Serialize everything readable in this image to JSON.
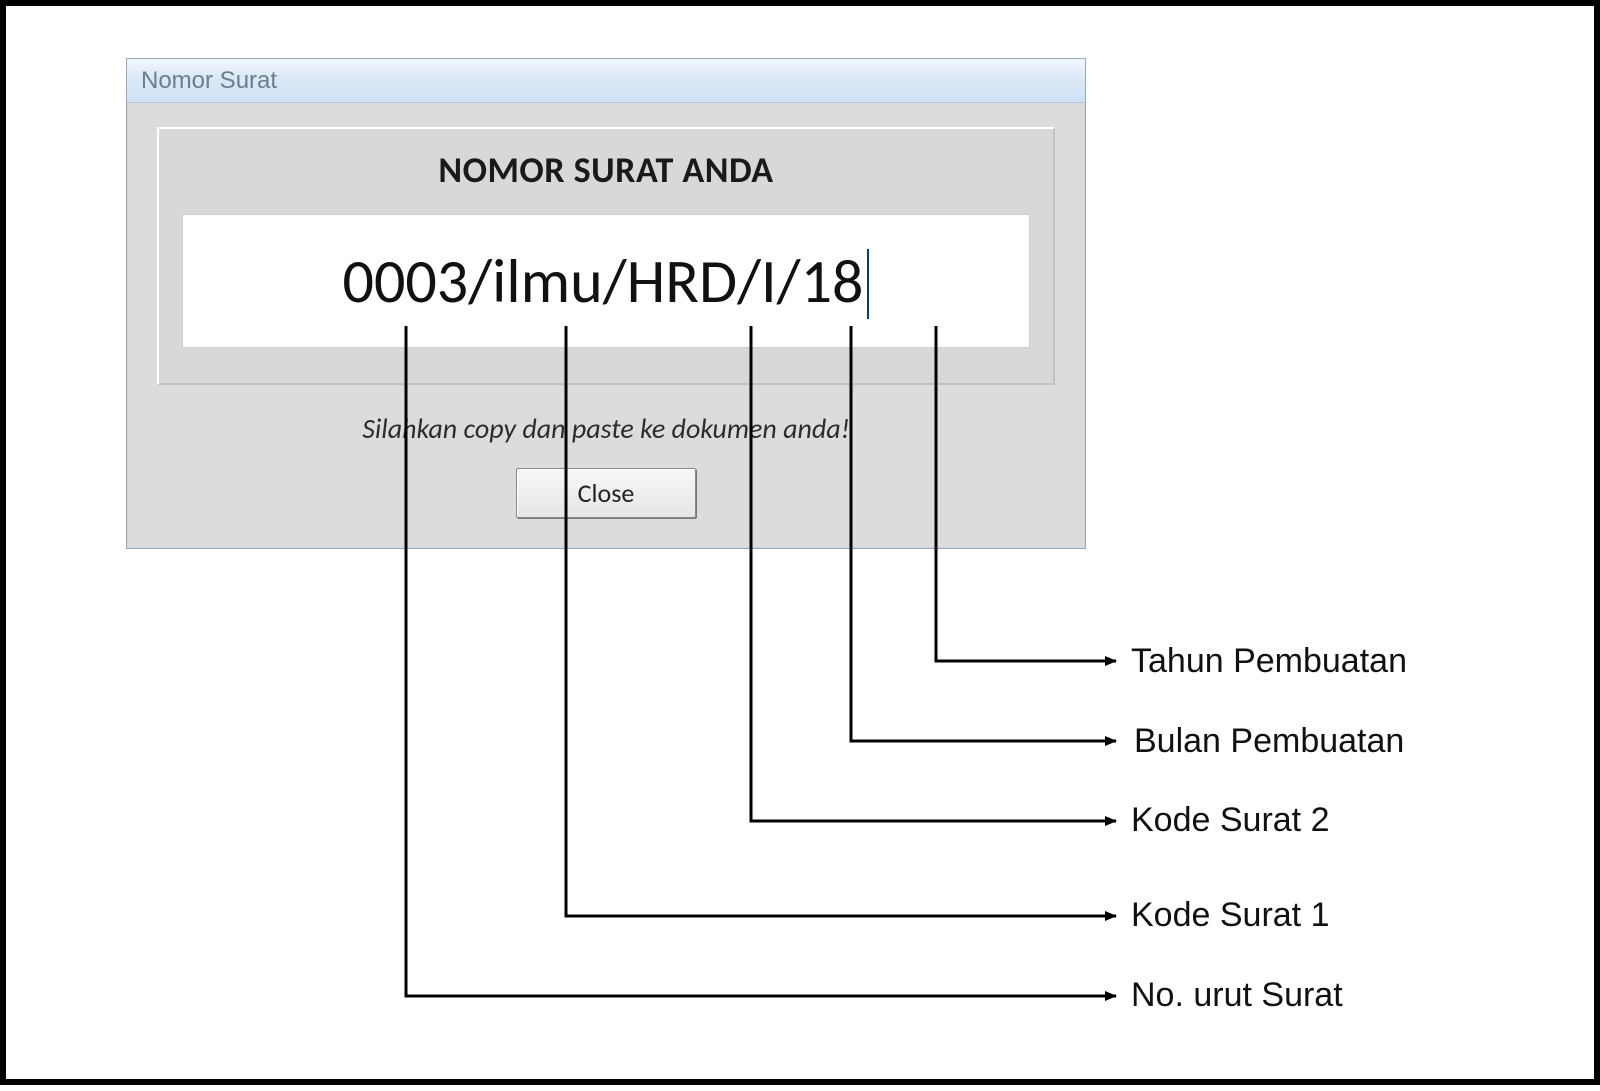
{
  "dialog": {
    "title": "Nomor Surat",
    "heading": "NOMOR SURAT ANDA",
    "value": "0003/ilmu/HRD/I/18",
    "hint": "Silahkan copy dan paste ke dokumen anda!",
    "close_label": "Close"
  },
  "annotations": {
    "tahun": "Tahun Pembuatan",
    "bulan": "Bulan Pembuatan",
    "kode2": "Kode Surat 2",
    "kode1": "Kode Surat 1",
    "nourut": "No. urut Surat"
  }
}
